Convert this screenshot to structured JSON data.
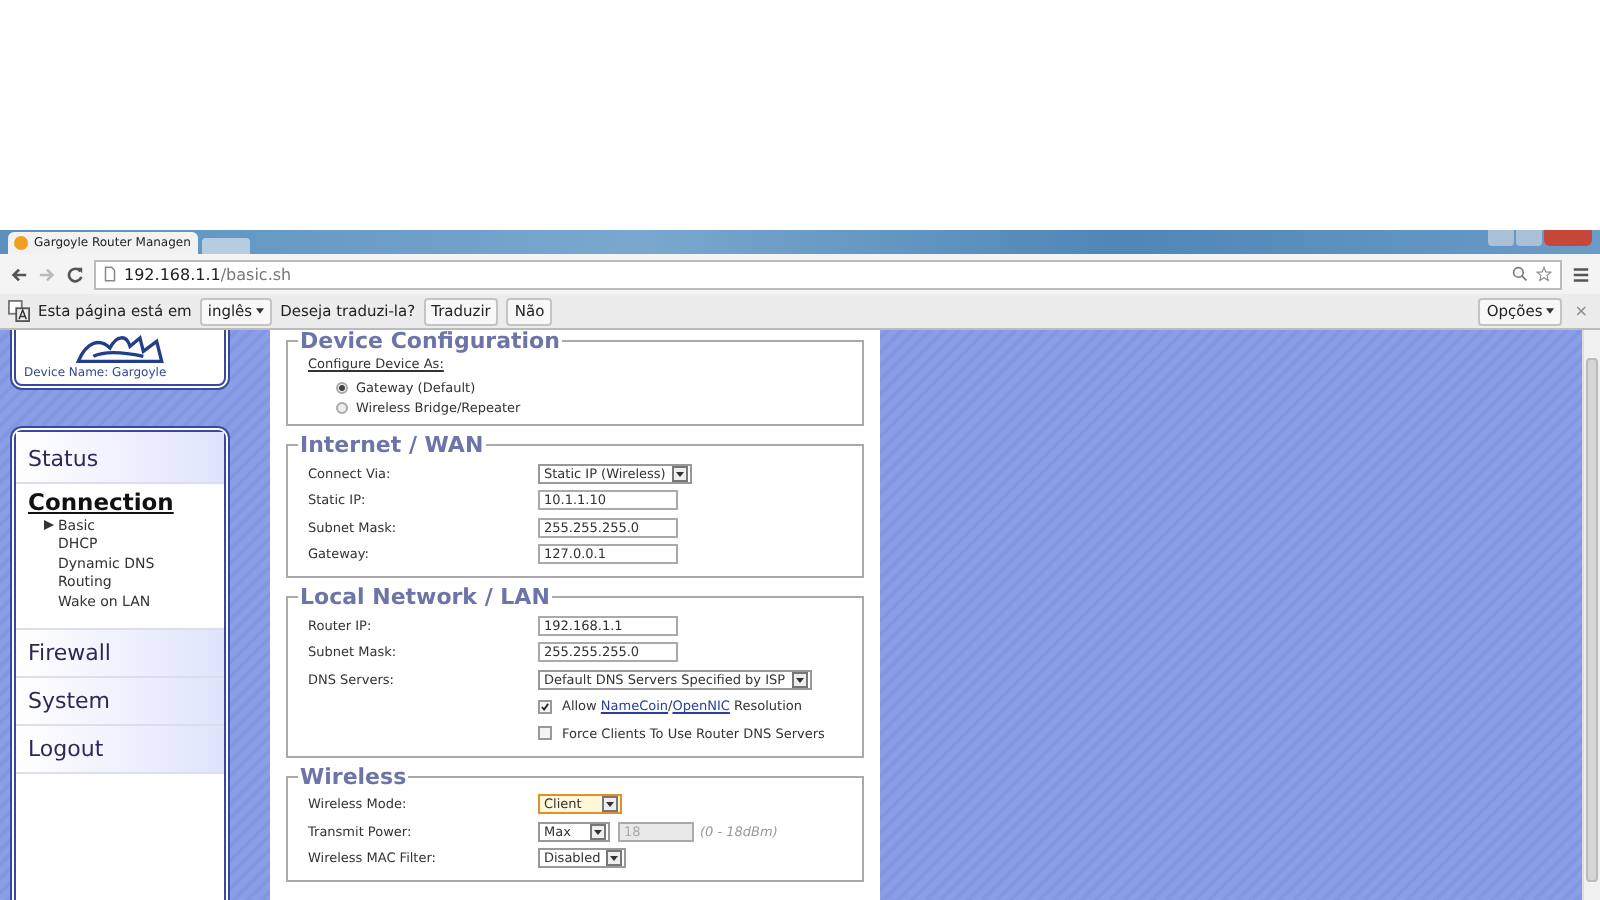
{
  "browser": {
    "tab_title": "Gargoyle Router Managen",
    "url_host": "192.168.1.1",
    "url_path": "/basic.sh",
    "translate": {
      "message": "Esta página está em",
      "language": "inglês",
      "question": "Deseja traduzi-la?",
      "translate_button": "Traduzir",
      "no_button": "Não",
      "options_button": "Opções",
      "close": "×"
    }
  },
  "sidebar": {
    "device_name": "Device Name: Gargoyle",
    "menu": [
      {
        "label": "Status",
        "selected": false
      },
      {
        "label": "Connection",
        "selected": true,
        "children": [
          {
            "label": "Basic",
            "selected": true
          },
          {
            "label": "DHCP",
            "selected": false
          },
          {
            "label": "Dynamic DNS",
            "selected": false
          },
          {
            "label": "Routing",
            "selected": false
          },
          {
            "label": "Wake on LAN",
            "selected": false
          }
        ]
      },
      {
        "label": "Firewall",
        "selected": false
      },
      {
        "label": "System",
        "selected": false
      },
      {
        "label": "Logout",
        "selected": false
      }
    ]
  },
  "sections": [
    {
      "title": "Device Configuration",
      "subtitle": "Configure Device As:",
      "radios": [
        {
          "label": "Gateway (Default)",
          "selected": true
        },
        {
          "label": "Wireless Bridge/Repeater",
          "selected": false
        }
      ]
    },
    {
      "title": "Internet / WAN",
      "rows": [
        {
          "kind": "select",
          "label": "Connect Via:",
          "value": "Static IP (Wireless)"
        },
        {
          "kind": "text",
          "label": "Static IP:",
          "value": "10.1.1.10"
        },
        {
          "kind": "text",
          "label": "Subnet Mask:",
          "value": "255.255.255.0"
        },
        {
          "kind": "text",
          "label": "Gateway:",
          "value": "127.0.0.1"
        }
      ]
    },
    {
      "title": "Local Network / LAN",
      "rows": [
        {
          "kind": "text",
          "label": "Router IP:",
          "value": "192.168.1.1"
        },
        {
          "kind": "text",
          "label": "Subnet Mask:",
          "value": "255.255.255.0"
        },
        {
          "kind": "select",
          "label": "DNS Servers:",
          "value": "Default DNS Servers Specified by ISP"
        },
        {
          "kind": "checkbox",
          "checked": true,
          "parts": [
            {
              "text": "Allow "
            },
            {
              "text": "NameCoin",
              "link": true
            },
            {
              "text": "/"
            },
            {
              "text": "OpenNIC",
              "link": true
            },
            {
              "text": " Resolution"
            }
          ]
        },
        {
          "kind": "checkbox",
          "checked": false,
          "parts": [
            {
              "text": "Force Clients To Use Router DNS Servers"
            }
          ]
        }
      ]
    },
    {
      "title": "Wireless",
      "rows": [
        {
          "kind": "select",
          "label": "Wireless Mode:",
          "value": "Client",
          "focused": true
        },
        {
          "kind": "power",
          "label": "Transmit Power:",
          "value": "Max",
          "extra": "18",
          "hint": "(0 - 18dBm)"
        },
        {
          "kind": "select",
          "label": "Wireless MAC Filter:",
          "value": "Disabled"
        }
      ]
    }
  ]
}
